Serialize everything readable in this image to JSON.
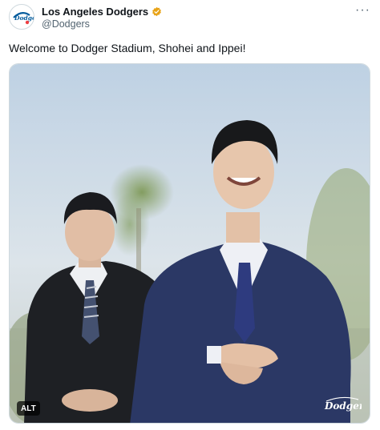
{
  "post": {
    "author": {
      "display_name": "Los Angeles Dodgers",
      "handle": "@Dodgers",
      "verified": true,
      "verified_color": "#e8a317"
    },
    "more_label": "···",
    "text": "Welcome to Dodger Stadium, Shohei and Ippei!",
    "media": {
      "alt_label": "ALT",
      "watermark": "Dodgers"
    }
  },
  "colors": {
    "text_primary": "#0f1419",
    "text_secondary": "#536471",
    "dodger_blue": "#005a9c",
    "suit_navy": "#23305f"
  }
}
